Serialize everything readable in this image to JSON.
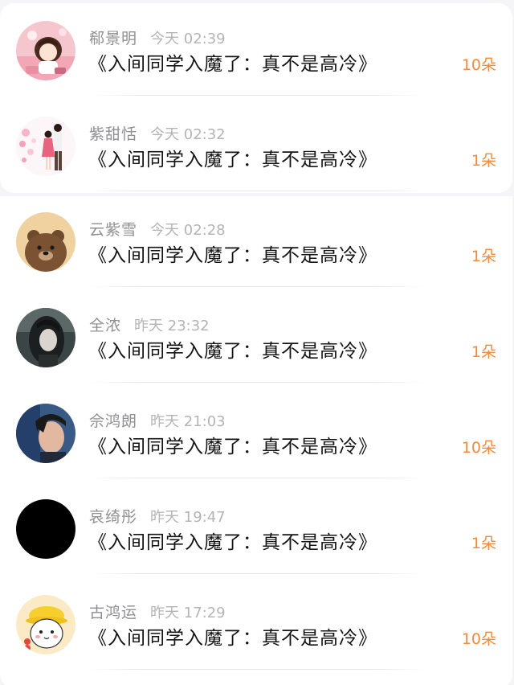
{
  "entries": [
    {
      "name": "郗景明",
      "time": "今天 02:39",
      "book": "《入间同学入魔了：真不是高冷》",
      "gift": "10朵",
      "avatar": "anime-girl-pink-room-avatar"
    },
    {
      "name": "紫甜恬",
      "time": "今天 02:32",
      "book": "《入间同学入魔了：真不是高冷》",
      "gift": "1朵",
      "avatar": "couple-illustration-avatar"
    },
    {
      "name": "云紫雪",
      "time": "今天 02:28",
      "book": "《入间同学入魔了：真不是高冷》",
      "gift": "1朵",
      "avatar": "brown-bear-avatar"
    },
    {
      "name": "全浓",
      "time": "昨天 23:32",
      "book": "《入间同学入魔了：真不是高冷》",
      "gift": "1朵",
      "avatar": "dark-haired-girl-avatar"
    },
    {
      "name": "佘鸿朗",
      "time": "昨天 21:03",
      "book": "《入间同学入魔了：真不是高冷》",
      "gift": "10朵",
      "avatar": "young-man-portrait-avatar"
    },
    {
      "name": "哀绮彤",
      "time": "昨天 19:47",
      "book": "《入间同学入魔了：真不是高冷》",
      "gift": "1朵",
      "avatar": "black-circle-avatar"
    },
    {
      "name": "古鸿运",
      "time": "昨天 17:29",
      "book": "《入间同学入魔了：真不是高冷》",
      "gift": "10朵",
      "avatar": "cartoon-cat-yellow-hat-avatar"
    }
  ]
}
